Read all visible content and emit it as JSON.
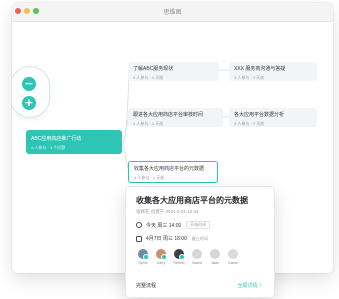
{
  "window": {
    "title": "思维图"
  },
  "nodes": [
    {
      "title": "了解ABC服务现状",
      "sub": "4 人参与 · 1 天前"
    },
    {
      "title": "XXX 服务商沟通与答疑",
      "sub": "3 人参与 · 2 天前"
    },
    {
      "title": "ABC应用商店推广行动",
      "sub": "4 人参与 · 3 个问题"
    },
    {
      "title": "跟进各大应用商店平台审核时间",
      "sub": "4 人参与 · 1 天前"
    },
    {
      "title": "各大应用平台数据分析",
      "sub": "3 人参与 · 2 天前"
    },
    {
      "title": "收集各大应用商店平台的元数据",
      "sub": "4 人参与 · 1 天前"
    }
  ],
  "popover": {
    "title": "收集各大应用商店平台的元数据",
    "subtitle": "张辉在 创建于 2024-4-01 10:34",
    "time_row": {
      "label": "今天 周三 14:00",
      "tag": "开始时间"
    },
    "date_row": {
      "label": "4月7日 周三 18:00",
      "tag": "截止时间"
    },
    "people": [
      {
        "name": "Sylvie",
        "color": "#6b8ea8",
        "checked": true
      },
      {
        "name": "Garry",
        "color": "#c89268",
        "checked": true
      },
      {
        "name": "Redin4",
        "color": "#3d3d45",
        "checked": true
      },
      {
        "name": "Sasea",
        "color": "#d6d6da",
        "checked": false
      },
      {
        "name": "Jalan",
        "color": "#d6d6da",
        "checked": false
      },
      {
        "name": "Camie",
        "color": "#dadade",
        "checked": false
      }
    ],
    "footer_left": "完整流程",
    "footer_right": "全局详情 〉"
  },
  "colors": {
    "accent": "#2fc5b4"
  }
}
